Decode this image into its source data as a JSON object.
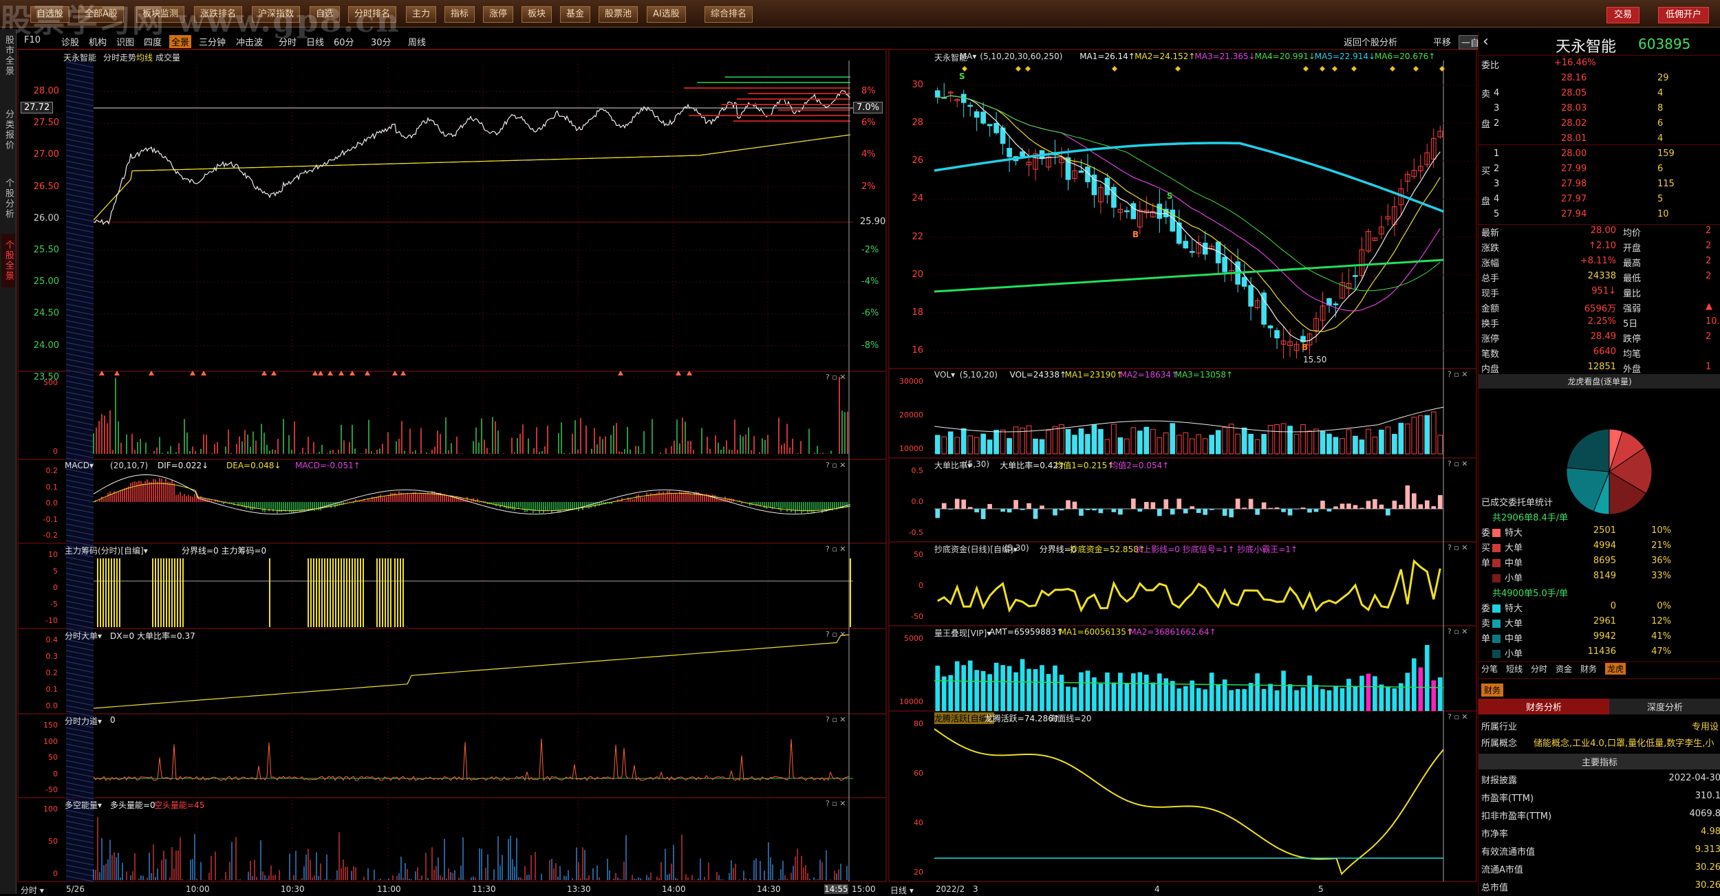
{
  "toolbar": {
    "buttons": [
      "自选股",
      "全部A股",
      "板块监测",
      "涨跌排名",
      "沪深指数",
      "自选",
      "分时排名",
      "主力",
      "指标",
      "涨停",
      "板块",
      "基金",
      "股票池",
      "AI选股",
      "综合排名"
    ],
    "watermark": "股票学习网 www.gp8.cn",
    "trade": "交易",
    "account": "低佣开户"
  },
  "left_tabs": [
    "股市全景",
    "分类报价",
    "个股分析",
    "个股全景"
  ],
  "subbar": {
    "items": [
      "F10",
      "诊股",
      "机构",
      "识图",
      "四度",
      "全景",
      "三分钟",
      "冲击波"
    ],
    "period": [
      "分时",
      "日线",
      "60分",
      "30分",
      "周线"
    ],
    "right": [
      "返回个股分析",
      "平移",
      "一自选"
    ]
  },
  "intraday": {
    "title": "天永智能",
    "mode": "分时走势",
    "avg_label": "均线",
    "vol_label": "成交量",
    "price_axis": [
      "28.00",
      "27.50",
      "27.00",
      "26.50",
      "26.00",
      "25.50",
      "25.00",
      "24.50",
      "24.00",
      "23.50"
    ],
    "pct_axis": [
      "8%",
      "6%",
      "4%",
      "2%",
      "",
      "-2%",
      "-4%",
      "-6%",
      "-8%"
    ],
    "current_price": "27.72",
    "current_pct": "7.0%",
    "prev_close": "25.90"
  },
  "intraday_panels": [
    {
      "name": "vol",
      "labels": [
        "500",
        "0"
      ]
    },
    {
      "name": "macd",
      "title": "MACD",
      "params": "(20,10,7)",
      "dif": "DIF=0.022↓",
      "dea": "DEA=0.048↓",
      "macd": "MACD=-0.051↑",
      "labels": [
        "0.2",
        "0.1",
        "0.0",
        "-0.1",
        "-0.2"
      ]
    },
    {
      "name": "zlcm",
      "title": "主力筹码(分时)[自编]",
      "info": "分界线=0 主力筹码=0",
      "labels": [
        "10",
        "5",
        "0",
        "-5",
        "-10"
      ]
    },
    {
      "name": "fsdd",
      "title": "分时大单",
      "info": "DX=0 大单比率=0.37",
      "labels": [
        "0.4",
        "0.3",
        "0.2",
        "0.1",
        "0.0"
      ]
    },
    {
      "name": "fsld",
      "title": "分时力道",
      "info": "0",
      "labels": [
        "150",
        "100",
        "50",
        "0",
        "-50"
      ]
    },
    {
      "name": "dkn",
      "title": "多空能量",
      "info": "多头量能=0",
      "info2": "空头量能=45",
      "labels": [
        "100",
        "50",
        "0"
      ]
    }
  ],
  "intraday_time": {
    "date": "5/26",
    "times": [
      "10:00",
      "10:30",
      "11:00",
      "11:30",
      "13:30",
      "14:00",
      "14:30",
      "14:55",
      "15:00"
    ]
  },
  "daily": {
    "title": "天永智能",
    "ma_label": "MA",
    "ma_params": "(5,10,20,30,60,250)",
    "ma1": "MA1=26.14↑",
    "ma2": "MA2=24.152↑",
    "ma3": "MA3=21.365↓",
    "ma4": "MA4=20.991↓",
    "ma5": "MA5=22.914↓",
    "ma6": "MA6=20.676↑",
    "price_axis": [
      "30",
      "28",
      "26",
      "24",
      "22",
      "20",
      "18",
      "16"
    ],
    "low_label": "15.50",
    "signal_s": "S",
    "signal_b": "B"
  },
  "daily_panels": [
    {
      "name": "vol",
      "title": "VOL",
      "params": "(5,10,20)",
      "info": "VOL=24338↑",
      "ma1": "MA1=23190↑",
      "ma2": "MA2=18634↑",
      "ma3": "MA3=13058↑",
      "labels": [
        "30000",
        "20000",
        "10000"
      ]
    },
    {
      "name": "ddbl",
      "title": "大单比率",
      "params": "(5,30)",
      "info": "大单比率=0.42↑",
      "v1": "均值1=0.215↑",
      "v2": "均值2=0.054↑",
      "labels": [
        "0.5",
        "0.0",
        "-0.5"
      ]
    },
    {
      "name": "cdzj",
      "title": "抄底资金(日线)[自编]",
      "params": "(5,30)",
      "info": "分界线=0",
      "v1": "抄底资金=52.858↑",
      "v2": "长上影线=0 抄底信号=1↑ 抄底小霸王=1↑",
      "labels": [
        "50",
        "0",
        "-50"
      ]
    },
    {
      "name": "lwxl",
      "title": "量王叠现[VIP]",
      "info": "AMT=65959883↑",
      "v1": "MA1=60056135↑",
      "v2": "MA2=36861662.64↑",
      "labels": [
        "5000",
        "10000"
      ]
    },
    {
      "name": "lths",
      "title": "龙腾活跃[自编]",
      "info": "龙腾活跃=74.286↑",
      "v1": "海面线=20",
      "labels": [
        "80",
        "60",
        "40",
        "20"
      ]
    }
  ],
  "daily_time": {
    "date": "2022/2",
    "months": [
      "3",
      "4",
      "5"
    ]
  },
  "right": {
    "name": "天永智能",
    "code": "603895",
    "wb": "委比",
    "wb_val": "+16.46%",
    "asks": [
      [
        "卖5",
        "28.16",
        "29"
      ],
      [
        "卖4",
        "28.05",
        "4"
      ],
      [
        "卖3",
        "28.03",
        "8"
      ],
      [
        "卖2",
        "28.02",
        "6"
      ],
      [
        "卖1",
        "28.01",
        "4"
      ]
    ],
    "bids": [
      [
        "买1",
        "28.00",
        "159"
      ],
      [
        "买2",
        "27.99",
        "6"
      ],
      [
        "买3",
        "27.98",
        "115"
      ],
      [
        "买4",
        "27.97",
        "5"
      ],
      [
        "买5",
        "27.94",
        "10"
      ]
    ],
    "stats": [
      [
        "最新",
        "28.00",
        "均价",
        "2"
      ],
      [
        "涨跌",
        "↑2.10",
        "开盘",
        "2"
      ],
      [
        "涨幅",
        "+8.11%",
        "最高",
        "2"
      ],
      [
        "总手",
        "24338",
        "最低",
        "2"
      ],
      [
        "现手",
        "951↓",
        "量比",
        ""
      ],
      [
        "金额",
        "6596万",
        "强弱",
        "▲"
      ],
      [
        "换手",
        "2.25%",
        "5日",
        "10."
      ],
      [
        "涨停",
        "28.49",
        "跌停",
        "2"
      ],
      [
        "笔数",
        "6640",
        "均笔",
        ""
      ],
      [
        "内盘",
        "12851",
        "外盘",
        "1"
      ]
    ],
    "pie_title": "龙虎看盘(逐单量)",
    "order_title": "已成交委托单统计",
    "buy_header": "共2906单8.4手/单",
    "buy_rows": [
      [
        "特大",
        "2501",
        "10%"
      ],
      [
        "大单",
        "4994",
        "21%"
      ],
      [
        "中单",
        "8695",
        "36%"
      ],
      [
        "小单",
        "8149",
        "33%"
      ]
    ],
    "sell_header": "共4900单5.0手/单",
    "sell_rows": [
      [
        "特大",
        "0",
        "0%"
      ],
      [
        "大单",
        "2961",
        "12%"
      ],
      [
        "中单",
        "9942",
        "41%"
      ],
      [
        "小单",
        "11436",
        "47%"
      ]
    ],
    "side_labels_buy": [
      "委",
      "买",
      "单"
    ],
    "side_labels_sell": [
      "委",
      "卖",
      "单"
    ],
    "tabs": [
      "分笔",
      "短线",
      "分时",
      "资金",
      "财务",
      "龙虎"
    ],
    "fin_tab": "财务",
    "fin_sub": [
      "财务分析",
      "深度分析"
    ],
    "industry_label": "所属行业",
    "industry": "专用设",
    "concept_label": "所属概念",
    "concept": "储能概念,工业4.0,口罩,量化低量,数字李生,小",
    "main_idx": "主要指标",
    "fin": [
      [
        "财报披露",
        "2022-04-30"
      ],
      [
        "市盈率(TTM)",
        "310.1"
      ],
      [
        "扣非市盈率(TTM)",
        "4069.8"
      ],
      [
        "市净率",
        "4.98"
      ],
      [
        "有效流通市值",
        "9.313"
      ],
      [
        "流通A市值",
        "30.26"
      ],
      [
        "总市值",
        "30.26"
      ]
    ]
  },
  "colors": {
    "up": "#ff4040",
    "down": "#40e0f0",
    "yellow": "#f0e020",
    "accent": "#d07010"
  }
}
